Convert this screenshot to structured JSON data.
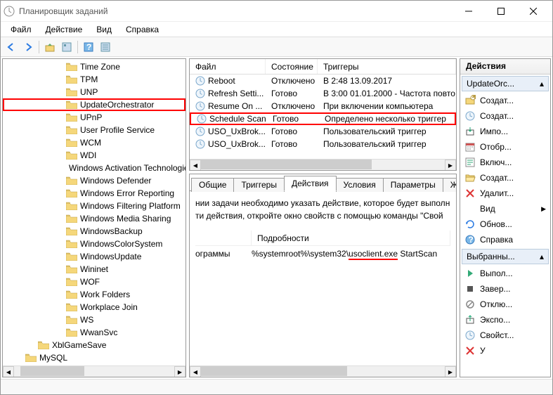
{
  "window": {
    "title": "Планировщик заданий"
  },
  "menubar": [
    "Файл",
    "Действие",
    "Вид",
    "Справка"
  ],
  "tree": [
    {
      "label": "Time Zone",
      "level": 2
    },
    {
      "label": "TPM",
      "level": 2
    },
    {
      "label": "UNP",
      "level": 2
    },
    {
      "label": "UpdateOrchestrator",
      "level": 2,
      "highlight": true
    },
    {
      "label": "UPnP",
      "level": 2
    },
    {
      "label": "User Profile Service",
      "level": 2
    },
    {
      "label": "WCM",
      "level": 2
    },
    {
      "label": "WDI",
      "level": 2
    },
    {
      "label": "Windows Activation Technologies",
      "level": 2
    },
    {
      "label": "Windows Defender",
      "level": 2
    },
    {
      "label": "Windows Error Reporting",
      "level": 2
    },
    {
      "label": "Windows Filtering Platform",
      "level": 2
    },
    {
      "label": "Windows Media Sharing",
      "level": 2
    },
    {
      "label": "WindowsBackup",
      "level": 2
    },
    {
      "label": "WindowsColorSystem",
      "level": 2
    },
    {
      "label": "WindowsUpdate",
      "level": 2
    },
    {
      "label": "Wininet",
      "level": 2
    },
    {
      "label": "WOF",
      "level": 2
    },
    {
      "label": "Work Folders",
      "level": 2
    },
    {
      "label": "Workplace Join",
      "level": 2
    },
    {
      "label": "WS",
      "level": 2
    },
    {
      "label": "WwanSvc",
      "level": 2
    },
    {
      "label": "XblGameSave",
      "level": 1
    },
    {
      "label": "MySQL",
      "level": 0
    }
  ],
  "tasklist": {
    "columns": [
      "Файл",
      "Состояние",
      "Триггеры"
    ],
    "rows": [
      {
        "name": "Reboot",
        "state": "Отключено",
        "trigger": "В 2:48 13.09.2017"
      },
      {
        "name": "Refresh Setti...",
        "state": "Готово",
        "trigger": "В 3:00 01.01.2000 - Частота повто"
      },
      {
        "name": "Resume On ...",
        "state": "Отключено",
        "trigger": "При включении компьютера"
      },
      {
        "name": "Schedule Scan",
        "state": "Готово",
        "trigger": "Определено несколько триггер",
        "highlight": true
      },
      {
        "name": "USO_UxBrok...",
        "state": "Готово",
        "trigger": "Пользовательский триггер"
      },
      {
        "name": "USO_UxBrok...",
        "state": "Готово",
        "trigger": "Пользовательский триггер"
      }
    ]
  },
  "details": {
    "tabs": [
      "Общие",
      "Триггеры",
      "Действия",
      "Условия",
      "Параметры",
      "Жу"
    ],
    "active_index": 2,
    "text1": "нии задачи необходимо указать действие, которое будет выполн",
    "text2": "ти действия, откройте окно свойств с помощью команды \"Свой",
    "cols": [
      "",
      "Подробности"
    ],
    "row_label": "ограммы",
    "row_value_pre": "%systemroot%\\system32\\",
    "row_value_underline": "usoclient.exe",
    "row_value_post": " StartScan"
  },
  "actions": {
    "header": "Действия",
    "section1": "UpdateOrc...",
    "items1": [
      {
        "icon": "folder-new",
        "label": "Создат..."
      },
      {
        "icon": "clock",
        "label": "Создат..."
      },
      {
        "icon": "import",
        "label": "Импо..."
      },
      {
        "icon": "calendar",
        "label": "Отобр..."
      },
      {
        "icon": "toggle",
        "label": "Включ..."
      },
      {
        "icon": "folder-open",
        "label": "Создат..."
      },
      {
        "icon": "delete",
        "label": "Удалит..."
      },
      {
        "icon": "view",
        "label": "Вид",
        "arrow": true
      },
      {
        "icon": "refresh",
        "label": "Обнов..."
      },
      {
        "icon": "help",
        "label": "Справка"
      }
    ],
    "section2": "Выбранны...",
    "items2": [
      {
        "icon": "run",
        "label": "Выпол..."
      },
      {
        "icon": "stop",
        "label": "Завер..."
      },
      {
        "icon": "disable",
        "label": "Отклю..."
      },
      {
        "icon": "export",
        "label": "Экспо..."
      },
      {
        "icon": "properties",
        "label": "Свойст..."
      },
      {
        "icon": "delete",
        "label": "У"
      }
    ]
  }
}
